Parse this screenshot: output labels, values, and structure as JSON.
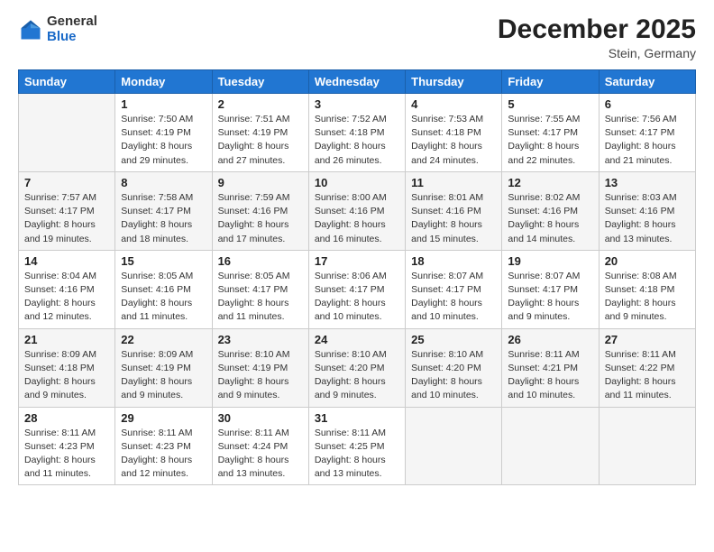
{
  "logo": {
    "general": "General",
    "blue": "Blue"
  },
  "title": "December 2025",
  "subtitle": "Stein, Germany",
  "days_header": [
    "Sunday",
    "Monday",
    "Tuesday",
    "Wednesday",
    "Thursday",
    "Friday",
    "Saturday"
  ],
  "weeks": [
    [
      {
        "day": "",
        "sunrise": "",
        "sunset": "",
        "daylight": ""
      },
      {
        "day": "1",
        "sunrise": "Sunrise: 7:50 AM",
        "sunset": "Sunset: 4:19 PM",
        "daylight": "Daylight: 8 hours and 29 minutes."
      },
      {
        "day": "2",
        "sunrise": "Sunrise: 7:51 AM",
        "sunset": "Sunset: 4:19 PM",
        "daylight": "Daylight: 8 hours and 27 minutes."
      },
      {
        "day": "3",
        "sunrise": "Sunrise: 7:52 AM",
        "sunset": "Sunset: 4:18 PM",
        "daylight": "Daylight: 8 hours and 26 minutes."
      },
      {
        "day": "4",
        "sunrise": "Sunrise: 7:53 AM",
        "sunset": "Sunset: 4:18 PM",
        "daylight": "Daylight: 8 hours and 24 minutes."
      },
      {
        "day": "5",
        "sunrise": "Sunrise: 7:55 AM",
        "sunset": "Sunset: 4:17 PM",
        "daylight": "Daylight: 8 hours and 22 minutes."
      },
      {
        "day": "6",
        "sunrise": "Sunrise: 7:56 AM",
        "sunset": "Sunset: 4:17 PM",
        "daylight": "Daylight: 8 hours and 21 minutes."
      }
    ],
    [
      {
        "day": "7",
        "sunrise": "Sunrise: 7:57 AM",
        "sunset": "Sunset: 4:17 PM",
        "daylight": "Daylight: 8 hours and 19 minutes."
      },
      {
        "day": "8",
        "sunrise": "Sunrise: 7:58 AM",
        "sunset": "Sunset: 4:17 PM",
        "daylight": "Daylight: 8 hours and 18 minutes."
      },
      {
        "day": "9",
        "sunrise": "Sunrise: 7:59 AM",
        "sunset": "Sunset: 4:16 PM",
        "daylight": "Daylight: 8 hours and 17 minutes."
      },
      {
        "day": "10",
        "sunrise": "Sunrise: 8:00 AM",
        "sunset": "Sunset: 4:16 PM",
        "daylight": "Daylight: 8 hours and 16 minutes."
      },
      {
        "day": "11",
        "sunrise": "Sunrise: 8:01 AM",
        "sunset": "Sunset: 4:16 PM",
        "daylight": "Daylight: 8 hours and 15 minutes."
      },
      {
        "day": "12",
        "sunrise": "Sunrise: 8:02 AM",
        "sunset": "Sunset: 4:16 PM",
        "daylight": "Daylight: 8 hours and 14 minutes."
      },
      {
        "day": "13",
        "sunrise": "Sunrise: 8:03 AM",
        "sunset": "Sunset: 4:16 PM",
        "daylight": "Daylight: 8 hours and 13 minutes."
      }
    ],
    [
      {
        "day": "14",
        "sunrise": "Sunrise: 8:04 AM",
        "sunset": "Sunset: 4:16 PM",
        "daylight": "Daylight: 8 hours and 12 minutes."
      },
      {
        "day": "15",
        "sunrise": "Sunrise: 8:05 AM",
        "sunset": "Sunset: 4:16 PM",
        "daylight": "Daylight: 8 hours and 11 minutes."
      },
      {
        "day": "16",
        "sunrise": "Sunrise: 8:05 AM",
        "sunset": "Sunset: 4:17 PM",
        "daylight": "Daylight: 8 hours and 11 minutes."
      },
      {
        "day": "17",
        "sunrise": "Sunrise: 8:06 AM",
        "sunset": "Sunset: 4:17 PM",
        "daylight": "Daylight: 8 hours and 10 minutes."
      },
      {
        "day": "18",
        "sunrise": "Sunrise: 8:07 AM",
        "sunset": "Sunset: 4:17 PM",
        "daylight": "Daylight: 8 hours and 10 minutes."
      },
      {
        "day": "19",
        "sunrise": "Sunrise: 8:07 AM",
        "sunset": "Sunset: 4:17 PM",
        "daylight": "Daylight: 8 hours and 9 minutes."
      },
      {
        "day": "20",
        "sunrise": "Sunrise: 8:08 AM",
        "sunset": "Sunset: 4:18 PM",
        "daylight": "Daylight: 8 hours and 9 minutes."
      }
    ],
    [
      {
        "day": "21",
        "sunrise": "Sunrise: 8:09 AM",
        "sunset": "Sunset: 4:18 PM",
        "daylight": "Daylight: 8 hours and 9 minutes."
      },
      {
        "day": "22",
        "sunrise": "Sunrise: 8:09 AM",
        "sunset": "Sunset: 4:19 PM",
        "daylight": "Daylight: 8 hours and 9 minutes."
      },
      {
        "day": "23",
        "sunrise": "Sunrise: 8:10 AM",
        "sunset": "Sunset: 4:19 PM",
        "daylight": "Daylight: 8 hours and 9 minutes."
      },
      {
        "day": "24",
        "sunrise": "Sunrise: 8:10 AM",
        "sunset": "Sunset: 4:20 PM",
        "daylight": "Daylight: 8 hours and 9 minutes."
      },
      {
        "day": "25",
        "sunrise": "Sunrise: 8:10 AM",
        "sunset": "Sunset: 4:20 PM",
        "daylight": "Daylight: 8 hours and 10 minutes."
      },
      {
        "day": "26",
        "sunrise": "Sunrise: 8:11 AM",
        "sunset": "Sunset: 4:21 PM",
        "daylight": "Daylight: 8 hours and 10 minutes."
      },
      {
        "day": "27",
        "sunrise": "Sunrise: 8:11 AM",
        "sunset": "Sunset: 4:22 PM",
        "daylight": "Daylight: 8 hours and 11 minutes."
      }
    ],
    [
      {
        "day": "28",
        "sunrise": "Sunrise: 8:11 AM",
        "sunset": "Sunset: 4:23 PM",
        "daylight": "Daylight: 8 hours and 11 minutes."
      },
      {
        "day": "29",
        "sunrise": "Sunrise: 8:11 AM",
        "sunset": "Sunset: 4:23 PM",
        "daylight": "Daylight: 8 hours and 12 minutes."
      },
      {
        "day": "30",
        "sunrise": "Sunrise: 8:11 AM",
        "sunset": "Sunset: 4:24 PM",
        "daylight": "Daylight: 8 hours and 13 minutes."
      },
      {
        "day": "31",
        "sunrise": "Sunrise: 8:11 AM",
        "sunset": "Sunset: 4:25 PM",
        "daylight": "Daylight: 8 hours and 13 minutes."
      },
      {
        "day": "",
        "sunrise": "",
        "sunset": "",
        "daylight": ""
      },
      {
        "day": "",
        "sunrise": "",
        "sunset": "",
        "daylight": ""
      },
      {
        "day": "",
        "sunrise": "",
        "sunset": "",
        "daylight": ""
      }
    ]
  ]
}
